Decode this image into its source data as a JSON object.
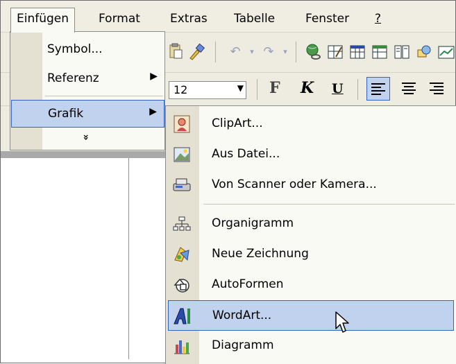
{
  "menubar": {
    "items": [
      "Einfügen",
      "Format",
      "Extras",
      "Tabelle",
      "Fenster",
      "?"
    ]
  },
  "toolbar": {
    "font_size": "12",
    "bold_label": "F",
    "italic_label": "K",
    "underline_label": "U"
  },
  "menu_einfuegen": {
    "items": [
      {
        "label": "Symbol...",
        "has_submenu": false
      },
      {
        "label": "Referenz",
        "has_submenu": true
      },
      {
        "label": "Grafik",
        "has_submenu": true,
        "selected": true
      }
    ],
    "more_glyph": "»"
  },
  "menu_grafik": {
    "items": [
      {
        "label": "ClipArt...",
        "icon": "clipart-icon"
      },
      {
        "label": "Aus Datei...",
        "icon": "picture-file-icon"
      },
      {
        "label": "Von Scanner oder Kamera...",
        "icon": "scanner-icon"
      },
      {
        "label": "Organigramm",
        "icon": "org-chart-icon"
      },
      {
        "label": "Neue Zeichnung",
        "icon": "drawing-icon"
      },
      {
        "label": "AutoFormen",
        "icon": "autoshapes-icon"
      },
      {
        "label": "WordArt...",
        "icon": "wordart-icon",
        "selected": true
      },
      {
        "label": "Diagramm",
        "icon": "chart-icon"
      }
    ]
  },
  "colors": {
    "selection_fill": "#c1d2ee",
    "selection_border": "#3163c5",
    "menu_bg": "#fafaf5",
    "menu_strip": "#e4e1d2"
  }
}
